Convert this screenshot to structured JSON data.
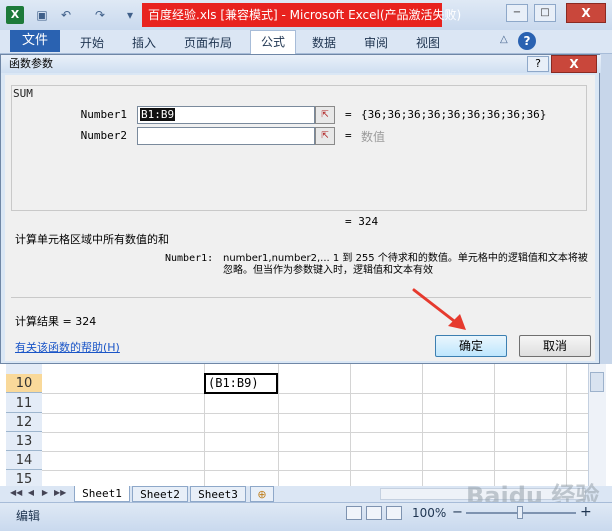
{
  "window": {
    "title": "百度经验.xls  [兼容模式]  -  Microsoft Excel(产品激活失败)",
    "logo_letter": "X",
    "minimize": "−",
    "maximize": "□",
    "close": "X"
  },
  "ribbon": {
    "tabs": [
      {
        "label": "文件"
      },
      {
        "label": "开始"
      },
      {
        "label": "插入"
      },
      {
        "label": "页面布局"
      },
      {
        "label": "公式"
      },
      {
        "label": "数据"
      },
      {
        "label": "审阅"
      },
      {
        "label": "视图"
      }
    ],
    "active_tab": "公式"
  },
  "dialog": {
    "title": "函数参数",
    "help": "?",
    "close": "X",
    "function_name": "SUM",
    "args": [
      {
        "label": "Number1",
        "value": "B1:B9",
        "result": "{36;36;36;36;36;36;36;36;36}"
      },
      {
        "label": "Number2",
        "value": "",
        "result": "数值"
      }
    ],
    "equals": "=",
    "ref_icon": "⇱",
    "formula_result_inline": "= 324",
    "function_description": "计算单元格区域中所有数值的和",
    "arg_help_label": "Number1:",
    "arg_help_text": "number1,number2,...  1 到 255 个待求和的数值。单元格中的逻辑值和文本将被忽略。但当作为参数键入时，逻辑值和文本有效",
    "calc_result": "计算结果 =  324",
    "help_link": "有关该函数的帮助(H)",
    "ok_label": "确定",
    "cancel_label": "取消"
  },
  "sheet": {
    "rows": [
      "10",
      "11",
      "12",
      "13",
      "14",
      "15"
    ],
    "active_cell_text": "(B1:B9)"
  },
  "sheet_tabs": {
    "tabs": [
      "Sheet1",
      "Sheet2",
      "Sheet3"
    ],
    "new_tab_icon": "⊕",
    "nav": [
      "◀◀",
      "◀",
      "▶",
      "▶▶"
    ]
  },
  "status_bar": {
    "mode": "编辑",
    "zoom": "100%",
    "zoom_minus": "−",
    "zoom_plus": "+"
  },
  "watermark": "Baidu 经验",
  "colors": {
    "title_highlight": "#e8231f",
    "file_tab": "#2a62b1",
    "arrow": "#e63a2e"
  }
}
